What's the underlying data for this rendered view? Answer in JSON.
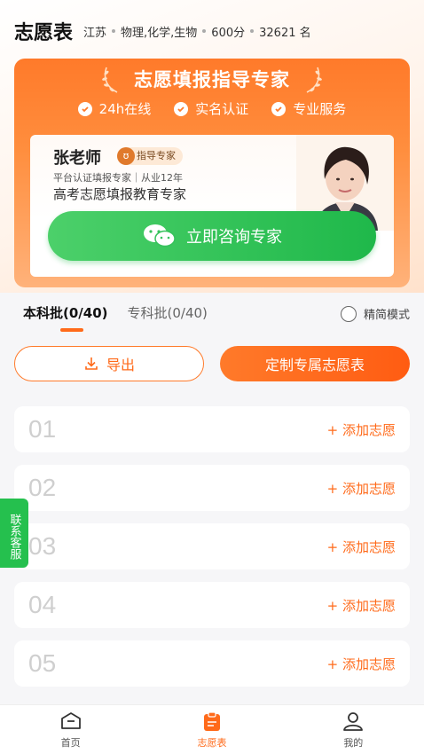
{
  "header": {
    "title": "志愿表",
    "province": "江苏",
    "subjects": "物理,化学,生物",
    "score": "600分",
    "rank": "32621 名"
  },
  "banner": {
    "title": "志愿填报指导专家",
    "badges": [
      "24h在线",
      "实名认证",
      "专业服务"
    ],
    "teacher_name": "张老师",
    "expert_tag": "指导专家",
    "teacher_sub": "平台认证填报专家｜从业12年",
    "teacher_desc": "高考志愿填报教育专家",
    "consult_button": "立即咨询专家"
  },
  "tabs": [
    {
      "label": "本科批(0/40)",
      "active": true
    },
    {
      "label": "专科批(0/40)",
      "active": false
    }
  ],
  "simple_mode_label": "精简模式",
  "actions": {
    "export_label": "导出",
    "custom_label": "定制专属志愿表"
  },
  "slots": [
    {
      "num": "01",
      "add_label": "+ 添加志愿"
    },
    {
      "num": "02",
      "add_label": "+ 添加志愿"
    },
    {
      "num": "03",
      "add_label": "+ 添加志愿"
    },
    {
      "num": "04",
      "add_label": "+ 添加志愿"
    },
    {
      "num": "05",
      "add_label": "+ 添加志愿"
    }
  ],
  "side_tab": "联系客服",
  "tabbar": [
    {
      "label": "首页",
      "icon": "home-icon",
      "active": false
    },
    {
      "label": "志愿表",
      "icon": "clipboard-icon",
      "active": true
    },
    {
      "label": "我的",
      "icon": "user-icon",
      "active": false
    }
  ],
  "colors": {
    "accent": "#ff6a1a",
    "green": "#25c04e"
  }
}
